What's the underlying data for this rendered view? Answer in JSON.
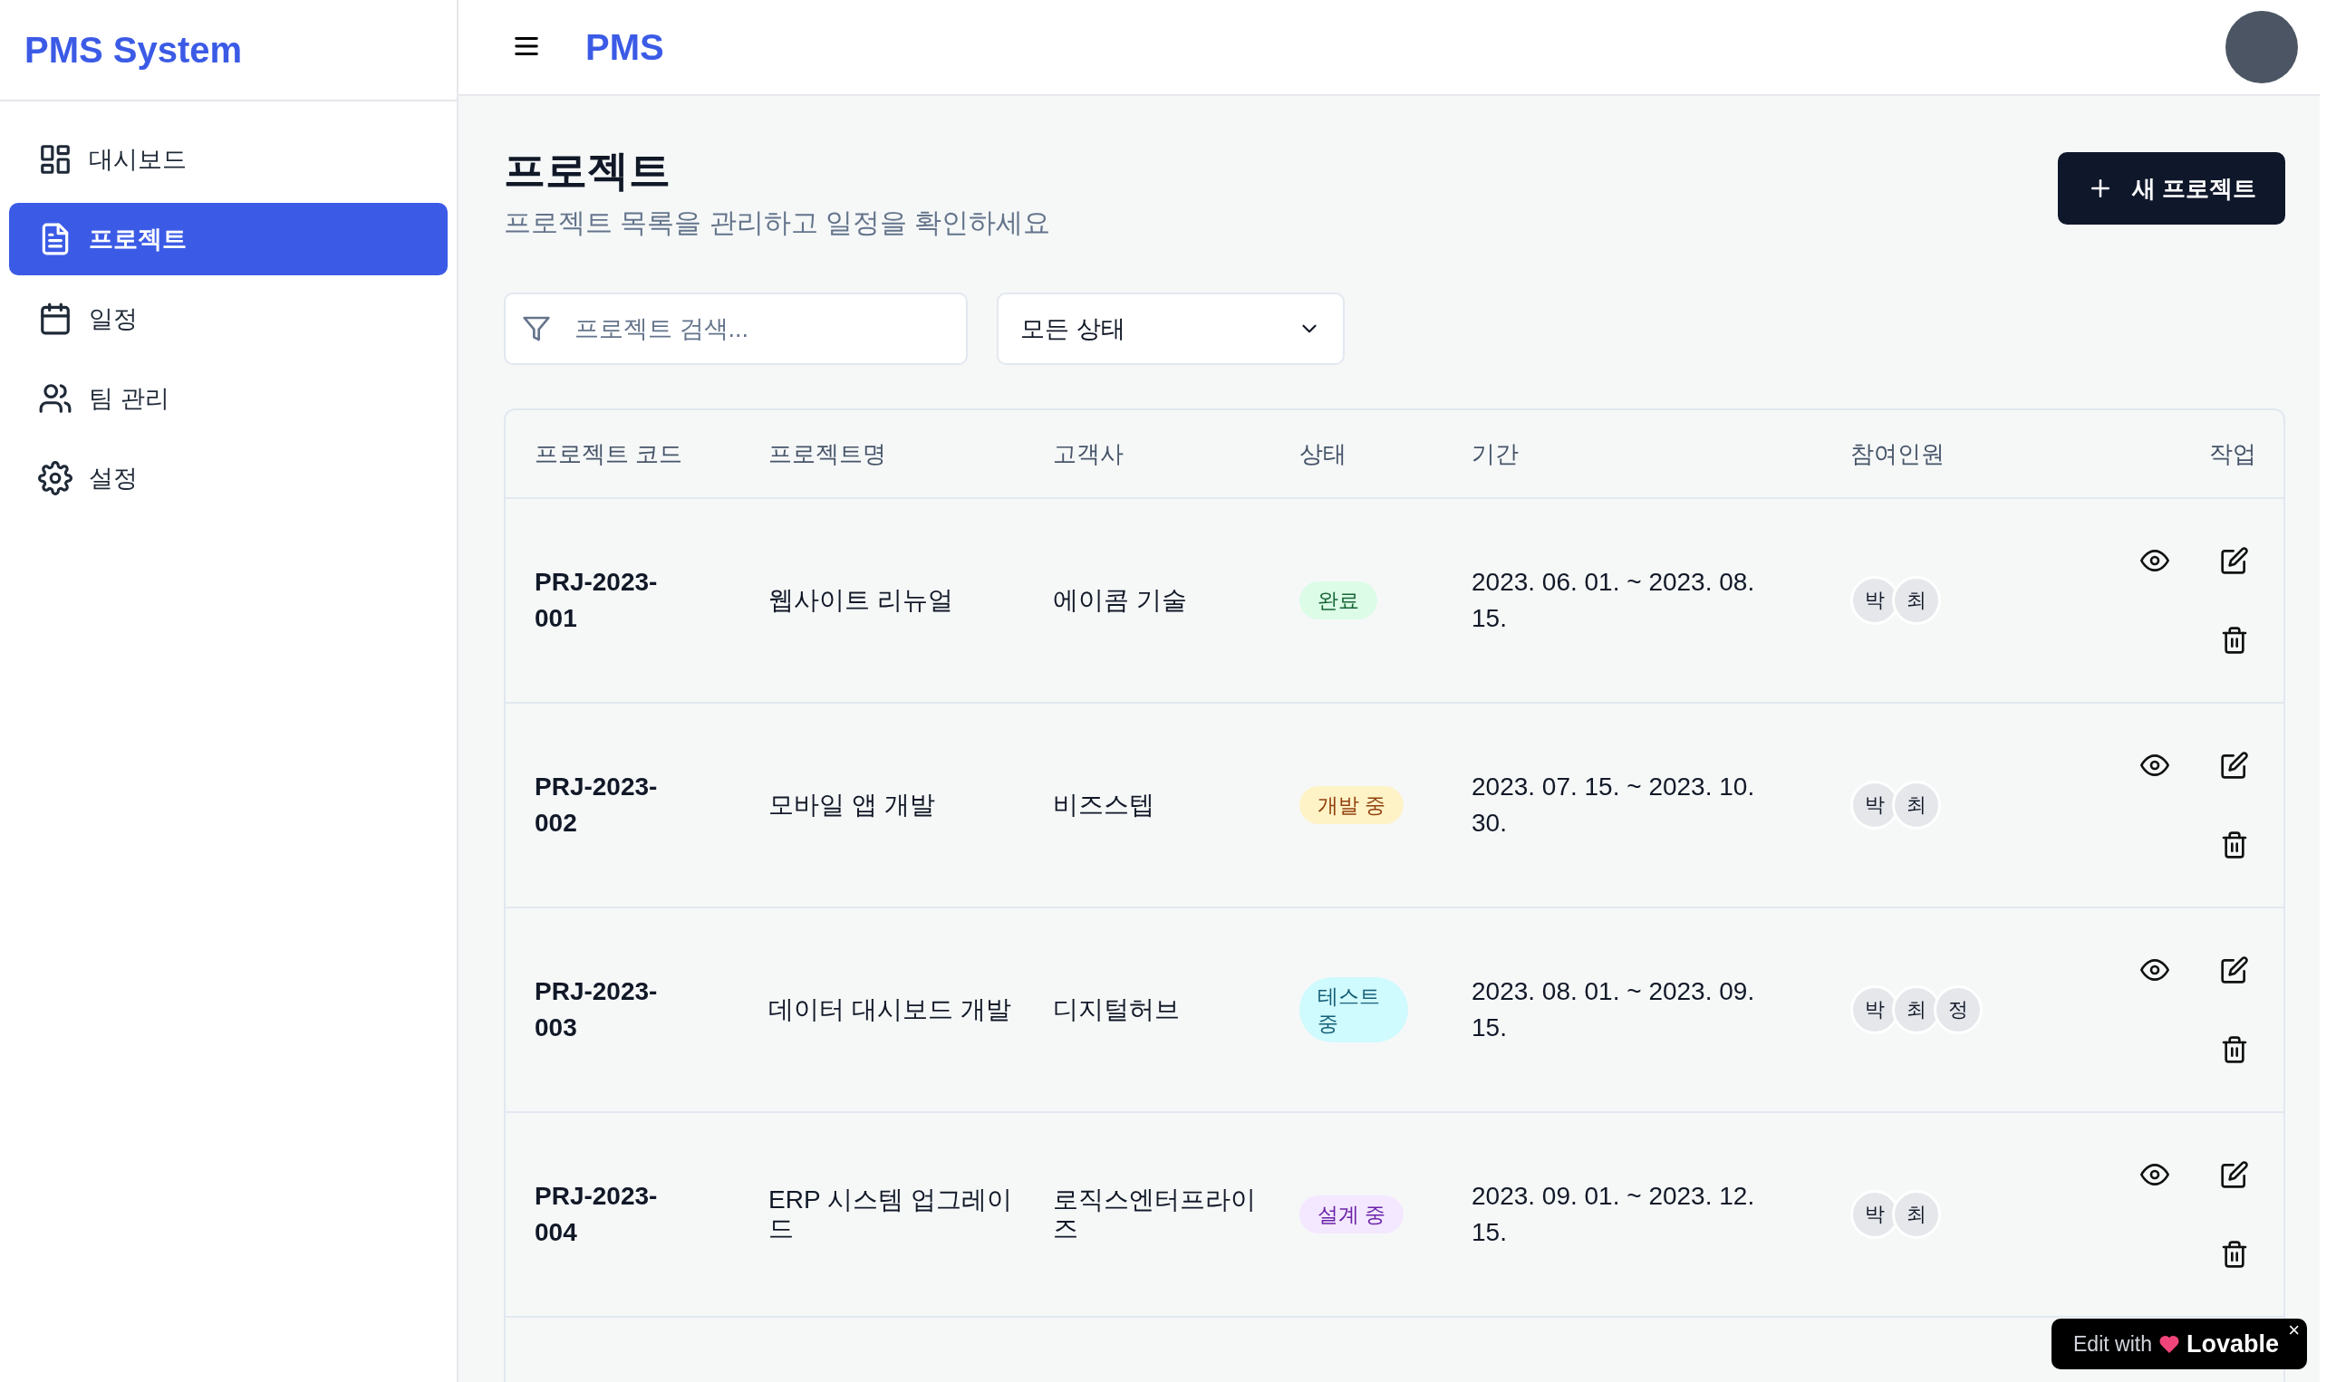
{
  "sidebar": {
    "logo": "PMS System",
    "items": [
      {
        "label": "대시보드",
        "selected": false
      },
      {
        "label": "프로젝트",
        "selected": true
      },
      {
        "label": "일정",
        "selected": false
      },
      {
        "label": "팀 관리",
        "selected": false
      },
      {
        "label": "설정",
        "selected": false
      }
    ]
  },
  "header": {
    "title": "PMS"
  },
  "page": {
    "title": "프로젝트",
    "subtitle": "프로젝트 목록을 관리하고 일정을 확인하세요",
    "new_button": "새 프로젝트"
  },
  "search": {
    "placeholder": "프로젝트 검색..."
  },
  "status_filter": {
    "value": "모든 상태"
  },
  "table": {
    "columns": [
      "프로젝트 코드",
      "프로젝트명",
      "고객사",
      "상태",
      "기간",
      "참여인원",
      "작업"
    ],
    "rows": [
      {
        "code": "PRJ-2023-001",
        "name": "웹사이트 리뉴얼",
        "client": "에이콤 기술",
        "status": {
          "label": "완료",
          "kind": "done"
        },
        "period": "2023. 06. 01. ~ 2023. 08. 15.",
        "members": [
          "박",
          "최"
        ]
      },
      {
        "code": "PRJ-2023-002",
        "name": "모바일 앱 개발",
        "client": "비즈스텝",
        "status": {
          "label": "개발 중",
          "kind": "dev"
        },
        "period": "2023. 07. 15. ~ 2023. 10. 30.",
        "members": [
          "박",
          "최"
        ]
      },
      {
        "code": "PRJ-2023-003",
        "name": "데이터 대시보드 개발",
        "client": "디지털허브",
        "status": {
          "label": "테스트 중",
          "kind": "test"
        },
        "period": "2023. 08. 01. ~ 2023. 09. 15.",
        "members": [
          "박",
          "최",
          "정"
        ]
      },
      {
        "code": "PRJ-2023-004",
        "name": "ERP 시스템 업그레이드",
        "client": "로직스엔터프라이즈",
        "status": {
          "label": "설계 중",
          "kind": "design"
        },
        "period": "2023. 09. 01. ~ 2023. 12. 15.",
        "members": [
          "박",
          "최"
        ]
      }
    ]
  },
  "badge": {
    "prefix": "Edit with",
    "brand": "Lovable",
    "close": "×"
  }
}
